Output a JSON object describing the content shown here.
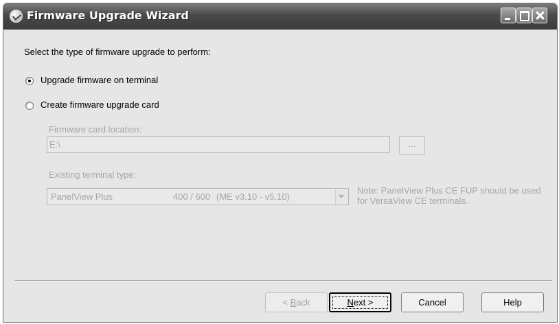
{
  "window": {
    "title": "Firmware Upgrade Wizard"
  },
  "main": {
    "prompt": "Select the type of firmware upgrade to perform:",
    "options": [
      {
        "label": "Upgrade firmware on terminal",
        "selected": true
      },
      {
        "label": "Create firmware upgrade card",
        "selected": false
      }
    ],
    "card_location": {
      "label": "Firmware card location:",
      "value": "E:\\",
      "browse_label": "..."
    },
    "terminal_type": {
      "label": "Existing terminal type:",
      "selected_name": "PanelView Plus",
      "selected_models": "400 / 600",
      "selected_version": "(ME v3.10 - v5.10)"
    },
    "note": "Note: PanelView Plus CE FUP should be used for VersaView CE terminals."
  },
  "footer": {
    "back_prefix": "< ",
    "back_key": "B",
    "back_rest": "ack",
    "next_key": "N",
    "next_rest": "ext >",
    "cancel_label": "Cancel",
    "help_label": "Help"
  }
}
